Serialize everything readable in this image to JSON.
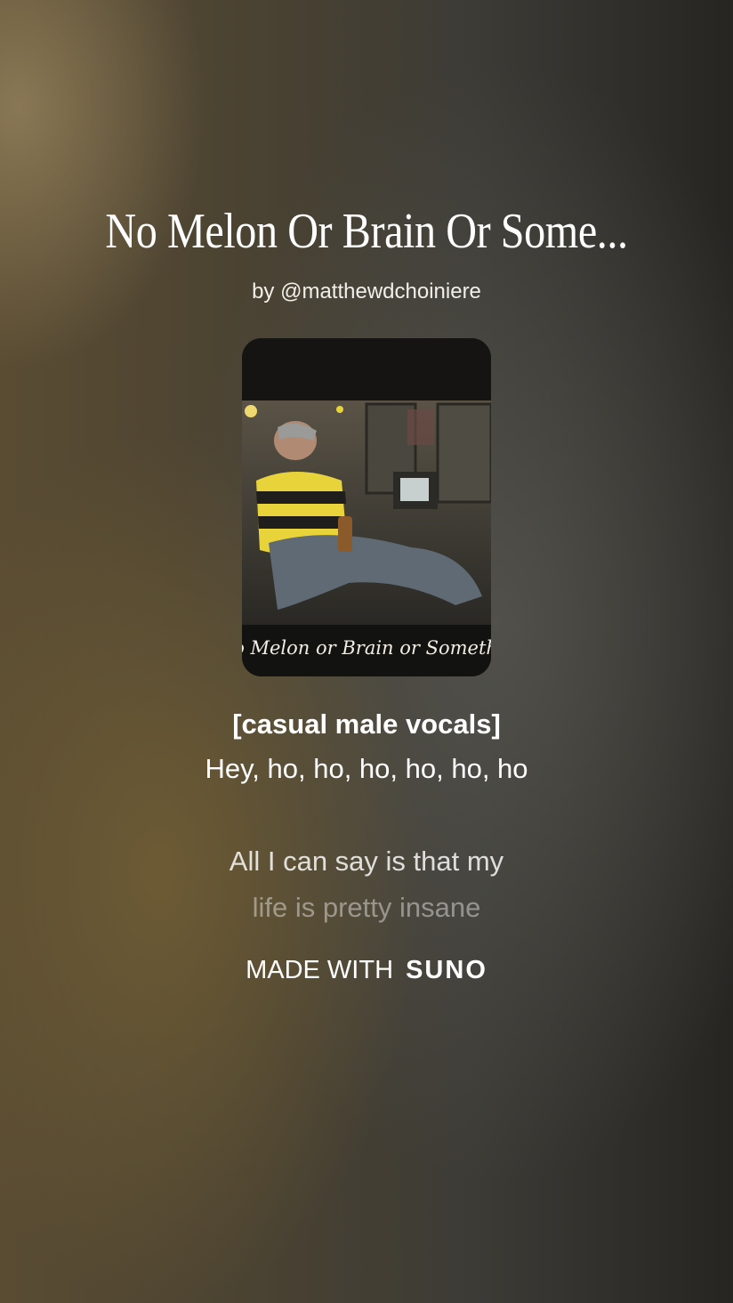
{
  "song": {
    "title": "No Melon Or Brain Or Some...",
    "byline": "by @matthewdchoiniere",
    "cover_text": "No Melon or Brain or Somethin"
  },
  "lyrics": [
    "[casual male vocals]",
    "Hey, ho, ho, ho, ho, ho, ho",
    "All I can say is that my",
    "life is pretty insane"
  ],
  "footer": {
    "made_with": "MADE WITH",
    "brand": "SUNO"
  },
  "colors": {
    "text": "#ffffff",
    "accent_yellow": "#e8d43a"
  }
}
